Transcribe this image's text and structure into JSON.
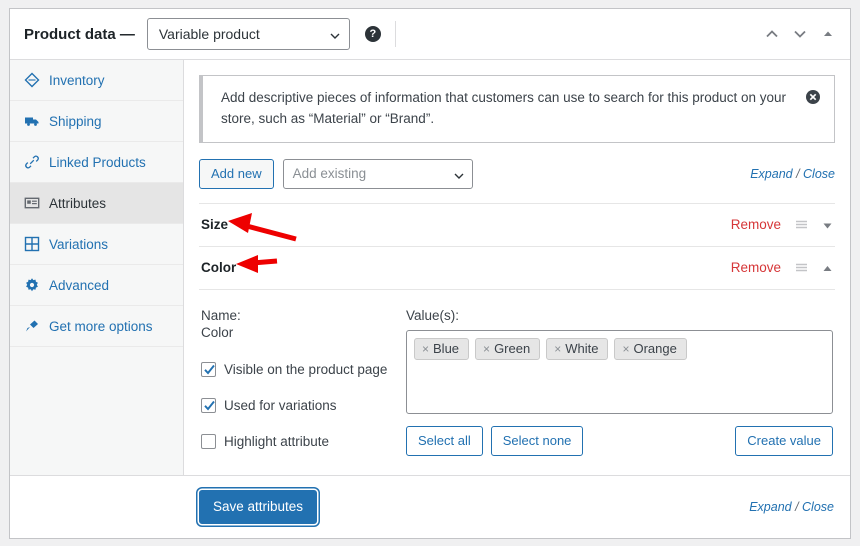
{
  "header": {
    "title": "Product data —",
    "product_type": "Variable product",
    "help_icon": "help-circle-icon",
    "move_up_icon": "chevron-up-icon",
    "move_down_icon": "chevron-down-icon",
    "toggle_icon": "triangle-up-icon"
  },
  "sidebar": {
    "items": [
      {
        "label": "Inventory",
        "icon": "inventory-icon",
        "active": false
      },
      {
        "label": "Shipping",
        "icon": "truck-icon",
        "active": false
      },
      {
        "label": "Linked Products",
        "icon": "link-icon",
        "active": false
      },
      {
        "label": "Attributes",
        "icon": "attributes-icon",
        "active": true
      },
      {
        "label": "Variations",
        "icon": "grid-icon",
        "active": false
      },
      {
        "label": "Advanced",
        "icon": "gear-icon",
        "active": false
      },
      {
        "label": "Get more options",
        "icon": "plug-icon",
        "active": false
      }
    ]
  },
  "notice": {
    "text": "Add descriptive pieces of information that customers can use to search for this product on your store, such as “Material” or “Brand”.",
    "dismiss_icon": "dismiss-circle-icon"
  },
  "toolbar": {
    "add_new_label": "Add new",
    "add_existing_placeholder": "Add existing",
    "dropdown_icon": "chevron-down-icon",
    "expand_label": "Expand",
    "separator": " / ",
    "close_label": "Close"
  },
  "attributes": [
    {
      "name": "Size",
      "remove_label": "Remove",
      "handle_icon": "drag-handle-icon",
      "toggle_icon": "triangle-down-icon",
      "expanded": false
    },
    {
      "name": "Color",
      "remove_label": "Remove",
      "handle_icon": "drag-handle-icon",
      "toggle_icon": "triangle-up-icon",
      "expanded": true
    }
  ],
  "attribute_detail": {
    "name_label": "Name:",
    "name_value": "Color",
    "values_label": "Value(s):",
    "values": [
      {
        "label": "Blue",
        "remove_icon": "chip-remove-icon"
      },
      {
        "label": "Green",
        "remove_icon": "chip-remove-icon"
      },
      {
        "label": "White",
        "remove_icon": "chip-remove-icon"
      },
      {
        "label": "Orange",
        "remove_icon": "chip-remove-icon"
      }
    ],
    "checkboxes": [
      {
        "label": "Visible on the product page",
        "checked": true
      },
      {
        "label": "Used for variations",
        "checked": true
      },
      {
        "label": "Highlight attribute",
        "checked": false
      }
    ],
    "select_all_label": "Select all",
    "select_none_label": "Select none",
    "create_value_label": "Create value"
  },
  "footer": {
    "save_label": "Save attributes",
    "expand_label": "Expand",
    "separator": " / ",
    "close_label": "Close"
  },
  "annotations": {
    "arrow_color": "#ee0000",
    "arrows": [
      {
        "name": "arrow-pointing-to-size"
      },
      {
        "name": "arrow-pointing-to-color"
      }
    ]
  },
  "colors": {
    "accent": "#2271b1",
    "danger": "#d63638",
    "panel_bg": "#ffffff",
    "sidebar_bg": "#f6f7f7",
    "active_item_bg": "#e5e5e5",
    "page_bg": "#f0f0f1"
  }
}
